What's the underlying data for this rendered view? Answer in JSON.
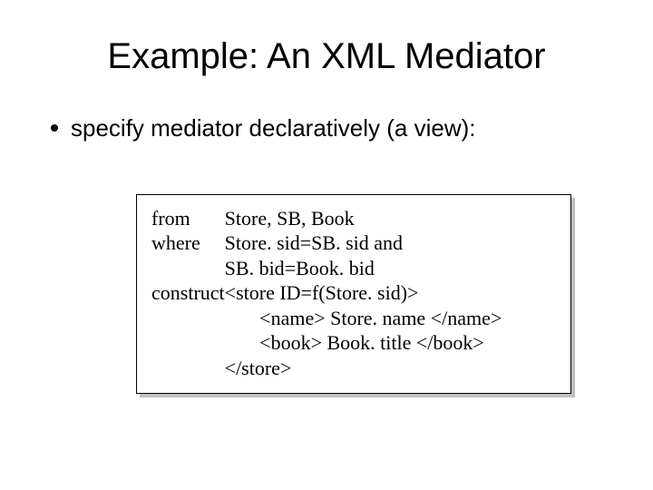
{
  "title": "Example: An XML Mediator",
  "bullet": "specify mediator declaratively (a view):",
  "code": {
    "kw_from": "from",
    "from_line": "Store,  SB,  Book",
    "kw_where": "where",
    "where_line1": "Store. sid=SB. sid and",
    "where_line2": "SB. bid=Book. bid",
    "kw_construct": "construct",
    "c_line1": "<store ID=f(Store. sid)>",
    "c_line2": "       <name> Store. name </name>",
    "c_line3": "       <book> Book. title </book>",
    "c_line4": "</store>"
  }
}
